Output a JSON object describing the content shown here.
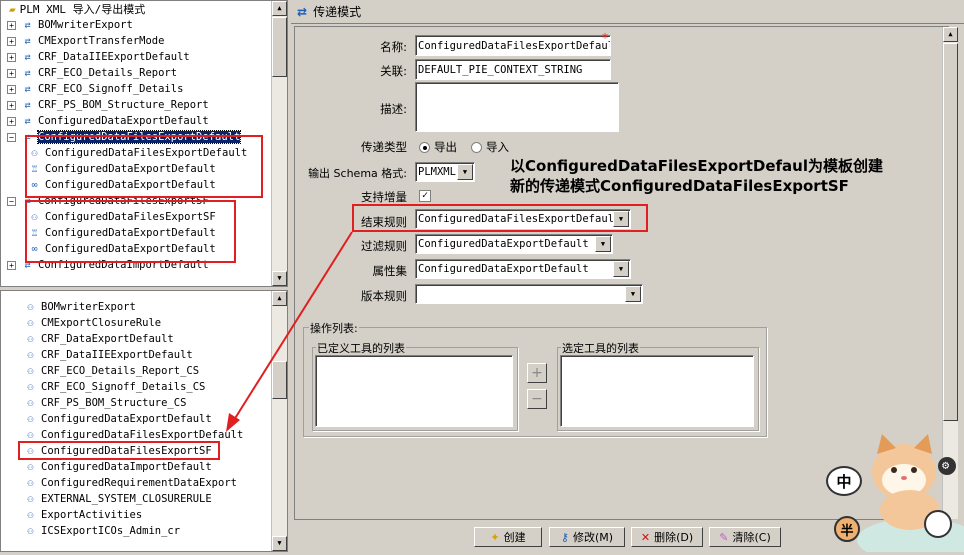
{
  "top_tree": {
    "title": "PLM XML 导入/导出模式",
    "items": [
      {
        "label": "BOMwriterExport",
        "indent": 0
      },
      {
        "label": "CMExportTransferMode",
        "indent": 0
      },
      {
        "label": "CRF_DataIIEExportDefault",
        "indent": 0
      },
      {
        "label": "CRF_ECO_Details_Report",
        "indent": 0
      },
      {
        "label": "CRF_ECO_Signoff_Details",
        "indent": 0
      },
      {
        "label": "CRF_PS_BOM_Structure_Report",
        "indent": 0
      },
      {
        "label": "ConfiguredDataExportDefault",
        "indent": 0
      },
      {
        "label": "ConfiguredDataFilesExportDefault",
        "indent": 0,
        "selected": true
      },
      {
        "label": "ConfiguredDataFilesExportDefault",
        "indent": 1
      },
      {
        "label": "ConfiguredDataExportDefault",
        "indent": 1
      },
      {
        "label": "ConfiguredDataExportDefault",
        "indent": 1
      },
      {
        "label": "ConfiguredDataFilesExportSF",
        "indent": 0
      },
      {
        "label": "ConfiguredDataFilesExportSF",
        "indent": 1
      },
      {
        "label": "ConfiguredDataExportDefault",
        "indent": 1
      },
      {
        "label": "ConfiguredDataExportDefault",
        "indent": 1
      },
      {
        "label": "ConfiguredDataImportDefault",
        "indent": 0
      }
    ]
  },
  "bottom_tree": {
    "items": [
      "BOMwriterExport",
      "CMExportClosureRule",
      "CRF_DataExportDefault",
      "CRF_DataIIEExportDefault",
      "CRF_ECO_Details_Report_CS",
      "CRF_ECO_Signoff_Details_CS",
      "CRF_PS_BOM_Structure_CS",
      "ConfiguredDataExportDefault",
      "ConfiguredDataFilesExportDefault",
      "ConfiguredDataFilesExportSF",
      "ConfiguredDataImportDefault",
      "ConfiguredRequirementDataExport",
      "EXTERNAL_SYSTEM_CLOSURERULE",
      "ExportActivities",
      "ICSExportICOs_Admin_cr"
    ]
  },
  "panel": {
    "title": "传递模式",
    "form": {
      "name_label": "名称:",
      "name_value": "ConfiguredDataFilesExportDefault",
      "required_mark": "*",
      "context_label": "关联:",
      "context_value": "DEFAULT_PIE_CONTEXT_STRING",
      "desc_label": "描述:",
      "desc_value": "",
      "type_label": "传递类型",
      "export_label": "导出",
      "import_label": "导入",
      "schema_label": "输出 Schema 格式:",
      "schema_value": "PLMXML",
      "incremental_label": "支持增量",
      "closure_label": "结束规则",
      "closure_value": "ConfiguredDataFilesExportDefault",
      "filter_label": "过滤规则",
      "filter_value": "ConfiguredDataExportDefault",
      "propset_label": "属性集",
      "propset_value": "ConfiguredDataExportDefault",
      "revrule_label": "版本规则",
      "revrule_value": "",
      "actions_label": "操作列表:",
      "defined_tools_label": "已定义工具的列表",
      "selected_tools_label": "选定工具的列表",
      "add_symbol": "+",
      "remove_symbol": "−"
    },
    "buttons": {
      "create": "创建",
      "modify": "修改(M)",
      "delete": "删除(D)",
      "clear": "清除(C)"
    }
  },
  "annotation": {
    "line1": "以ConfiguredDataFilesExportDefaul为模板创建",
    "line2": "新的传递模式ConfiguredDataFilesExportSF"
  },
  "overlay": {
    "char_zhong": "中",
    "char_ban": "半"
  },
  "colors": {
    "highlight": "#e02020",
    "selection": "#0a246a",
    "icon_blue": "#1d5fb8"
  }
}
